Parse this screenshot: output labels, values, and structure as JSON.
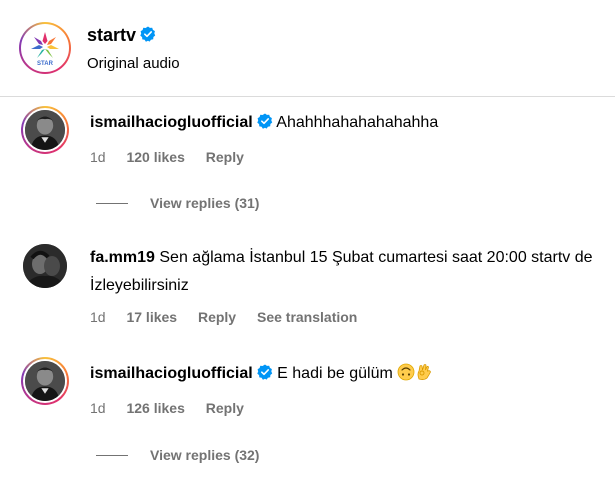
{
  "header": {
    "account_name": "startv",
    "subtitle": "Original audio",
    "logo_text": "STAR"
  },
  "comments": [
    {
      "username": "ismailhaciogluofficial",
      "verified": true,
      "text": "Ahahhhahahahahahha",
      "time": "1d",
      "likes": "120 likes",
      "reply_label": "Reply",
      "view_replies": "View replies (31)"
    },
    {
      "username": "fa.mm19",
      "verified": false,
      "text": "Sen ağlama İstanbul 15 Şubat cumartesi saat 20:00 startv de İzleyebilirsiniz",
      "time": "1d",
      "likes": "17 likes",
      "reply_label": "Reply",
      "translation_label": "See translation"
    },
    {
      "username": "ismailhaciogluofficial",
      "verified": true,
      "text": "E hadi be gülüm",
      "emojis": [
        "upside-down-face-icon",
        "ok-hand-icon"
      ],
      "time": "1d",
      "likes": "126 likes",
      "reply_label": "Reply",
      "view_replies": "View replies (32)"
    }
  ],
  "colors": {
    "verified_blue": "#0095f6",
    "meta_gray": "#737373",
    "divider": "#dbdbdb"
  }
}
